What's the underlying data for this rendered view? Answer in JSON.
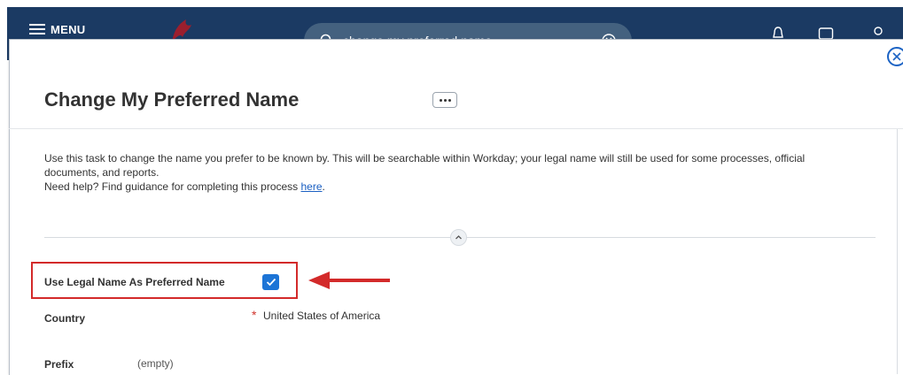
{
  "header": {
    "menu_label": "MENU",
    "search_text": "change my preferred name"
  },
  "task": {
    "title": "Change My Preferred Name",
    "instructions_line1": "Use this task to change the name you prefer to be known by. This will be searchable within Workday; your legal name will still be used for some processes, official documents, and reports.",
    "help_prefix": "Need help? Find guidance for completing this process ",
    "help_link": "here",
    "help_suffix": "."
  },
  "fields": {
    "use_legal_name": {
      "label": "Use Legal Name As Preferred Name",
      "checked": true
    },
    "country": {
      "label": "Country",
      "value": "United States of America",
      "required_marker": "*"
    },
    "prefix": {
      "label": "Prefix",
      "value": "(empty)"
    }
  },
  "colors": {
    "header_bg": "#1b3a63",
    "checkbox_blue": "#1c74d6",
    "annotation_red": "#d32a2a",
    "link_blue": "#1a5fc2"
  }
}
